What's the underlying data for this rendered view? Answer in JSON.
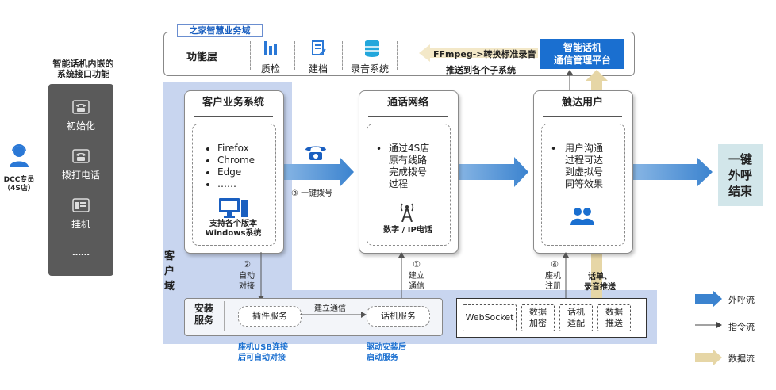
{
  "colors": {
    "accent_blue": "#1a6fd0",
    "client_domain_bg": "#c8d5ef",
    "flow_blue": "#3b83cf",
    "data_flow_tan": "#e6d6a6",
    "panel_gray": "#5a5a5a",
    "end_box": "#d2e6ea"
  },
  "left_panel": {
    "title": "智能话机内嵌的\n系统接口功能",
    "functions": [
      {
        "label": "初始化",
        "icon": "phone-icon"
      },
      {
        "label": "拨打电话",
        "icon": "phone-icon"
      },
      {
        "label": "挂机",
        "icon": "hangup-icon"
      }
    ],
    "more": "……"
  },
  "user": {
    "label": "DCC专员\n（4S店）",
    "icon": "user-icon"
  },
  "top_bar": {
    "tag": "之家智慧业务域",
    "layer": "功能层",
    "modules": [
      {
        "label": "质检",
        "icon": "chart-icon"
      },
      {
        "label": "建档",
        "icon": "document-icon"
      },
      {
        "label": "录音系统",
        "icon": "database-icon"
      }
    ],
    "ffmpeg": "FFmpeg->转换标准录音",
    "push": "推送到各个子系统",
    "platform": "智能话机\n通信管理平台"
  },
  "customer_system": {
    "title": "客户业务系统",
    "browsers": [
      "Firefox",
      "Chrome",
      "Edge",
      "……"
    ],
    "support": "支持各个版本\nWindows系统",
    "icon": "computer-icon"
  },
  "call_network": {
    "title": "通话网络",
    "desc": "通过4S店\n原有线路\n完成拨号\n过程",
    "caption": "数字 / IP电话",
    "icon": "antenna-icon"
  },
  "reach_user": {
    "title": "触达用户",
    "desc": "用户沟通\n过程可达\n到虚拟号\n同等效果",
    "icon": "users-icon"
  },
  "end_box": "一键\n外呼\n结束",
  "client_domain": "客\n户\n域",
  "steps": {
    "step1": {
      "num": "①",
      "label": "建立\n通信"
    },
    "step2": {
      "num": "②",
      "label": "自动\n对接"
    },
    "step3": {
      "num": "③",
      "label": "一键拨号"
    },
    "step4": {
      "num": "④",
      "label": "座机\n注册"
    }
  },
  "words_push": "话单、\n录音推送",
  "install": {
    "title": "安装\n服务",
    "plugin": "插件服务",
    "phone_service": "话机服务",
    "establish": "建立通信",
    "note_left": "座机USB连接\n后可自动对接",
    "note_right": "驱动安装后\n启动服务"
  },
  "protocol": [
    "WebSocket",
    "数据\n加密",
    "话机\n适配",
    "数据\n推送"
  ],
  "legend": [
    {
      "label": "外呼流"
    },
    {
      "label": "指令流"
    },
    {
      "label": "数据流"
    }
  ]
}
